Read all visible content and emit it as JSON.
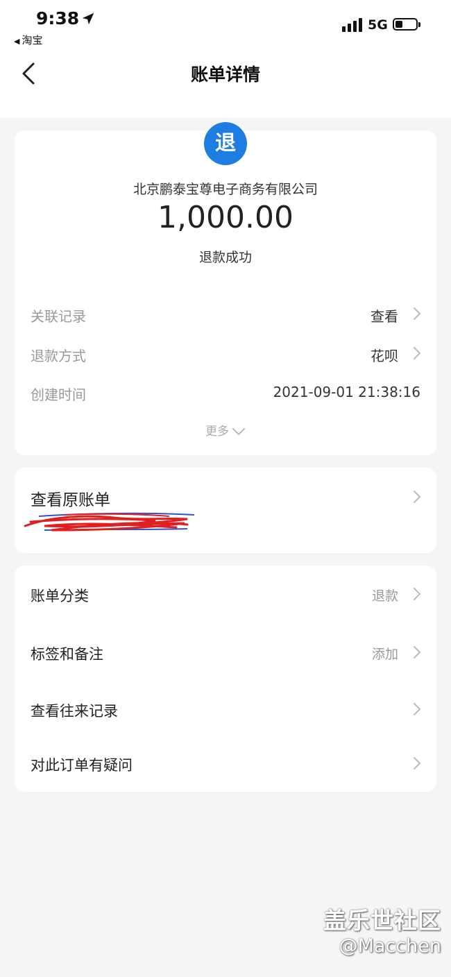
{
  "status_bar": {
    "time": "9:38",
    "back_app": "淘宝",
    "network": "5G"
  },
  "navbar": {
    "title": "账单详情"
  },
  "summary": {
    "icon_text": "退",
    "merchant": "北京鹏泰宝尊电子商务有限公司",
    "amount": "1,000.00",
    "status": "退款成功"
  },
  "details": [
    {
      "label": "关联记录",
      "value": "查看"
    },
    {
      "label": "退款方式",
      "value": "花呗"
    },
    {
      "label": "创建时间",
      "value": "2021-09-01 21:38:16"
    }
  ],
  "more_label": "更多",
  "original_bill": {
    "title": "查看原账单"
  },
  "menu": [
    {
      "label": "账单分类",
      "value": "退款"
    },
    {
      "label": "标签和备注",
      "value": "添加"
    },
    {
      "label": "查看往来记录",
      "value": ""
    },
    {
      "label": "对此订单有疑问",
      "value": ""
    }
  ],
  "watermark": {
    "line1": "盖乐世社区",
    "line2": "@Macchen"
  },
  "colors": {
    "accent": "#1e7de0",
    "background": "#f5f5f5",
    "scribble_red": "#e02020",
    "scribble_blue": "#3050d0"
  }
}
